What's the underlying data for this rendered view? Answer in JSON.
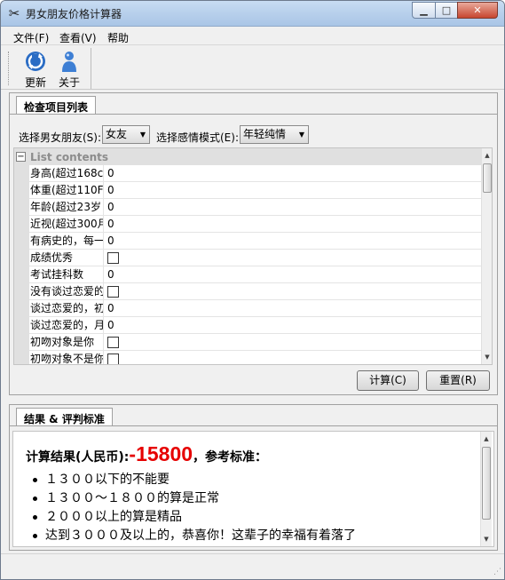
{
  "window": {
    "title": "男女朋友价格计算器"
  },
  "menu": {
    "file": "文件(F)",
    "view": "查看(V)",
    "help": "帮助"
  },
  "toolbar": {
    "update_label": "更新",
    "about_label": "关于"
  },
  "check_panel": {
    "tab": "检查项目列表",
    "partner_label": "选择男女朋友(S):",
    "partner_value": "女友",
    "mode_label": "选择感情模式(E):",
    "mode_value": "年轻纯情",
    "list_header": "List contents",
    "rows": [
      {
        "name": "身高(超过168c",
        "type": "number",
        "value": "0"
      },
      {
        "name": "体重(超过110F",
        "type": "number",
        "value": "0"
      },
      {
        "name": "年龄(超过23岁",
        "type": "number",
        "value": "0"
      },
      {
        "name": "近视(超过300月",
        "type": "number",
        "value": "0"
      },
      {
        "name": "有病史的，每一",
        "type": "number",
        "value": "0"
      },
      {
        "name": "成绩优秀",
        "type": "check",
        "value": ""
      },
      {
        "name": "考试挂科数",
        "type": "number",
        "value": "0"
      },
      {
        "name": "没有谈过恋爱的",
        "type": "check",
        "value": ""
      },
      {
        "name": "谈过恋爱的，初",
        "type": "number",
        "value": "0"
      },
      {
        "name": "谈过恋爱的，月",
        "type": "number",
        "value": "0"
      },
      {
        "name": "初吻对象是你",
        "type": "check",
        "value": ""
      },
      {
        "name": "初吻对象不是你",
        "type": "check",
        "value": ""
      }
    ],
    "calc_button": "计算(C)",
    "reset_button": "重置(R)"
  },
  "result_panel": {
    "tab": "结果 & 评判标准",
    "result_prefix": "计算结果(人民币):",
    "result_value": "-15800",
    "result_suffix": "，参考标准：",
    "criteria": [
      "１３００以下的不能要",
      "１３００～１８００的算是正常",
      "２０００以上的算是精品",
      "达到３０００及以上的，恭喜你！这辈子的幸福有着落了"
    ]
  },
  "icons": {
    "app": "scissors-icon",
    "update": "refresh-icon",
    "about": "person-icon"
  },
  "colors": {
    "result_value": "#e60000",
    "titlebar": "#b9d1ec"
  }
}
